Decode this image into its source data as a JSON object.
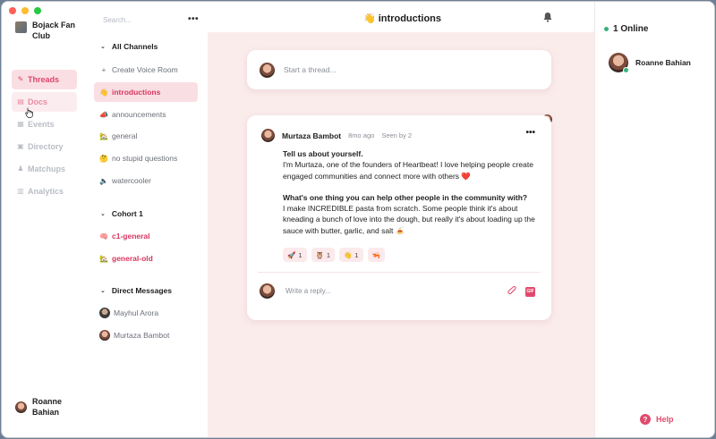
{
  "window": {
    "traffic_colors": [
      "#fe5f57",
      "#febc2e",
      "#28c840"
    ]
  },
  "community": {
    "name": "Bojack Fan Club"
  },
  "nav": {
    "items": [
      {
        "label": "Threads",
        "icon": "quill-icon",
        "state": "active"
      },
      {
        "label": "Docs",
        "icon": "doc-icon",
        "state": "hover"
      },
      {
        "label": "Events",
        "icon": "calendar-icon",
        "state": ""
      },
      {
        "label": "Directory",
        "icon": "directory-icon",
        "state": ""
      },
      {
        "label": "Matchups",
        "icon": "matchups-icon",
        "state": ""
      },
      {
        "label": "Analytics",
        "icon": "analytics-icon",
        "state": ""
      }
    ]
  },
  "current_user": {
    "name": "Roanne Bahian"
  },
  "channels": {
    "search_placeholder": "Search...",
    "all_channels_label": "All Channels",
    "create_voice_room": "Create Voice Room",
    "list": [
      {
        "label": "introductions",
        "emoji": "👋",
        "state": "active"
      },
      {
        "label": "announcements",
        "emoji": "📣",
        "state": ""
      },
      {
        "label": "general",
        "emoji": "🏡",
        "state": ""
      },
      {
        "label": "no stupid questions",
        "emoji": "🤔",
        "state": ""
      },
      {
        "label": "watercooler",
        "emoji": "🔈",
        "state": ""
      }
    ],
    "cohort_label": "Cohort 1",
    "cohort_list": [
      {
        "label": "c1-general",
        "emoji": "🧠"
      },
      {
        "label": "general-old",
        "emoji": "🏡"
      }
    ],
    "dm_label": "Direct Messages",
    "dms": [
      {
        "label": "Mayhul Arora"
      },
      {
        "label": "Murtaza Bambot"
      }
    ]
  },
  "header": {
    "title": "👋 introductions"
  },
  "composer": {
    "placeholder": "Start a thread..."
  },
  "post": {
    "author": "Murtaza Bambot",
    "time": "8mo ago",
    "seen": "Seen by 2",
    "q1": "Tell us about yourself.",
    "a1": "I'm Murtaza, one of the founders of Heartbeat! I love helping people create engaged communities and connect more with others ❤️",
    "q2": "What's one thing you can help other people in the community with?",
    "a2": "I make INCREDIBLE pasta from scratch. Some people think it's about kneading a bunch of love into the dough, but really it's about loading up the sauce with butter, garlic, and salt 🍝",
    "reactions": [
      {
        "emoji": "🚀",
        "count": "1"
      },
      {
        "emoji": "🦉",
        "count": "1"
      },
      {
        "emoji": "👋",
        "count": "1"
      },
      {
        "emoji": "🦐",
        "count": ""
      }
    ],
    "reply_placeholder": "Write a reply...",
    "gif_label": "GIF"
  },
  "online": {
    "label": "1 Online",
    "members": [
      {
        "name": "Roanne Bahian"
      }
    ]
  },
  "help": {
    "label": "Help"
  }
}
